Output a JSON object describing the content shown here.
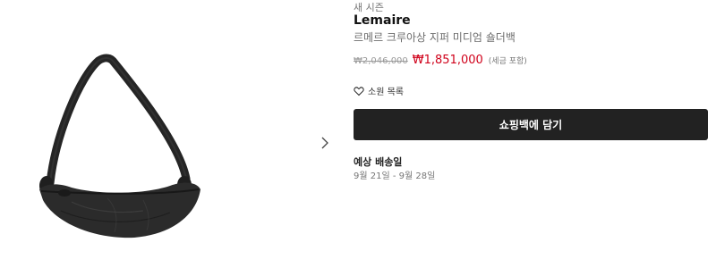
{
  "product": {
    "season_label": "새 시즌",
    "brand": "Lemaire",
    "name": "르메르 크루아상 지퍼 미디엄 숄더백",
    "original_price": "₩2,046,000",
    "sale_price": "₩1,851,000",
    "tax_note": "(세금 포함)"
  },
  "wishlist": {
    "label": "소원 목록",
    "icon": "heart-outline-icon"
  },
  "cart": {
    "button_label": "쇼핑백에 담기"
  },
  "delivery": {
    "title": "예상 배송일",
    "dates": "9월 21일 - 9월 28일"
  },
  "gallery": {
    "next_icon": "chevron-right-icon"
  },
  "colors": {
    "sale_price": "#d0021b",
    "button_bg": "#222222",
    "bag": "#2a2a2a"
  }
}
